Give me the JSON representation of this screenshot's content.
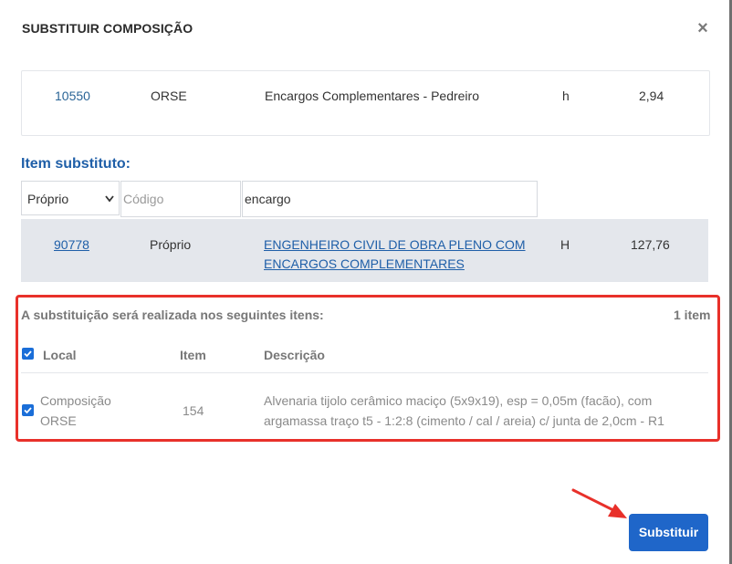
{
  "modal": {
    "title": "SUBSTITUIR COMPOSIÇÃO",
    "close_icon": "×"
  },
  "original_item": {
    "code": "10550",
    "source": "ORSE",
    "description": "Encargos Complementares - Pedreiro",
    "unit": "h",
    "price": "2,94"
  },
  "substitute": {
    "section_label": "Item substituto:",
    "source_select": {
      "value": "Próprio",
      "icon": "chevron-down-icon"
    },
    "code_input": {
      "value": "",
      "placeholder": "Código"
    },
    "search_input": {
      "value": "encargo"
    },
    "result": {
      "code": "90778",
      "source": "Próprio",
      "description_line1": "ENGENHEIRO CIVIL DE OBRA PLENO COM",
      "description_line2": "ENCARGOS COMPLEMENTARES",
      "unit": "H",
      "price": "127,76"
    }
  },
  "affected": {
    "intro": "A substituição será realizada nos seguintes itens:",
    "count": "1 item",
    "headers": {
      "local": "Local",
      "item": "Item",
      "description": "Descrição"
    },
    "rows": [
      {
        "checked": true,
        "local_line1": "Composição",
        "local_line2": "ORSE",
        "item": "154",
        "description_line1": "Alvenaria tijolo cerâmico maciço (5x9x19), esp = 0,05m (facão), com",
        "description_line2": "argamassa traço t5 - 1:2:8 (cimento / cal / areia) c/ junta de 2,0cm - R1"
      }
    ],
    "select_all_checked": true
  },
  "actions": {
    "submit_label": "Substituir"
  },
  "colors": {
    "primary": "#1f66c9",
    "highlight_border": "#e8302a",
    "link": "#1f5fa8"
  }
}
